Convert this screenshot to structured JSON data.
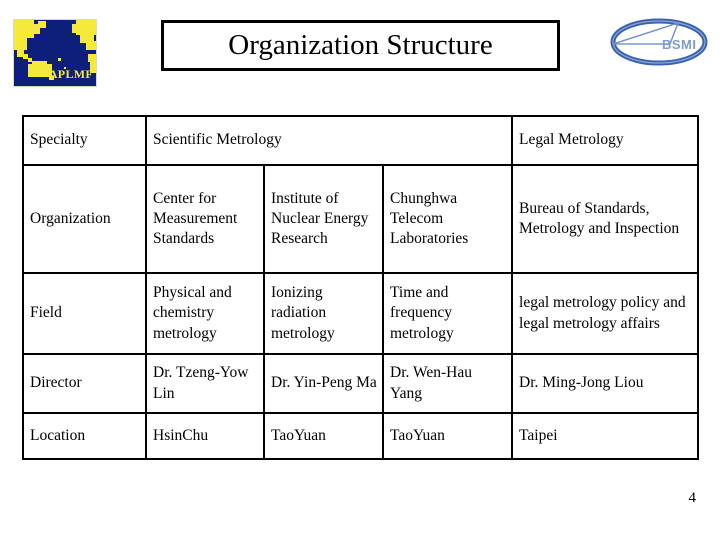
{
  "slide": {
    "title": "Organization Structure",
    "page_number": "4"
  },
  "logos": {
    "left": {
      "name": "aplmf-logo",
      "label": "APLMF",
      "map_color": "#f5e93c",
      "ocean_color": "#0d1f7a"
    },
    "right": {
      "name": "bsmi-logo",
      "label": "BSMI",
      "accent_color": "#3b62ad"
    }
  },
  "table": {
    "columns": [
      "Specialty",
      "Scientific Metrology",
      "Legal Metrology"
    ],
    "header": {
      "row_label": "Specialty",
      "scientific": "Scientific Metrology",
      "legal": "Legal Metrology"
    },
    "rows": [
      {
        "label": "Organization",
        "cells": [
          "Center for Measurement Standards",
          "Institute of Nuclear Energy Research",
          "Chunghwa Telecom Laboratories",
          "Bureau of Standards, Metrology and Inspection"
        ]
      },
      {
        "label": "Field",
        "cells": [
          "Physical and chemistry metrology",
          "Ionizing radiation metrology",
          "Time and frequency metrology",
          "legal metrology policy and legal metrology affairs"
        ]
      },
      {
        "label": "Director",
        "cells": [
          "Dr. Tzeng-Yow Lin",
          "Dr. Yin-Peng Ma",
          "Dr. Wen-Hau Yang",
          "Dr. Ming-Jong Liou"
        ]
      },
      {
        "label": "Location",
        "cells": [
          "HsinChu",
          "TaoYuan",
          "TaoYuan",
          "Taipei"
        ]
      }
    ]
  }
}
